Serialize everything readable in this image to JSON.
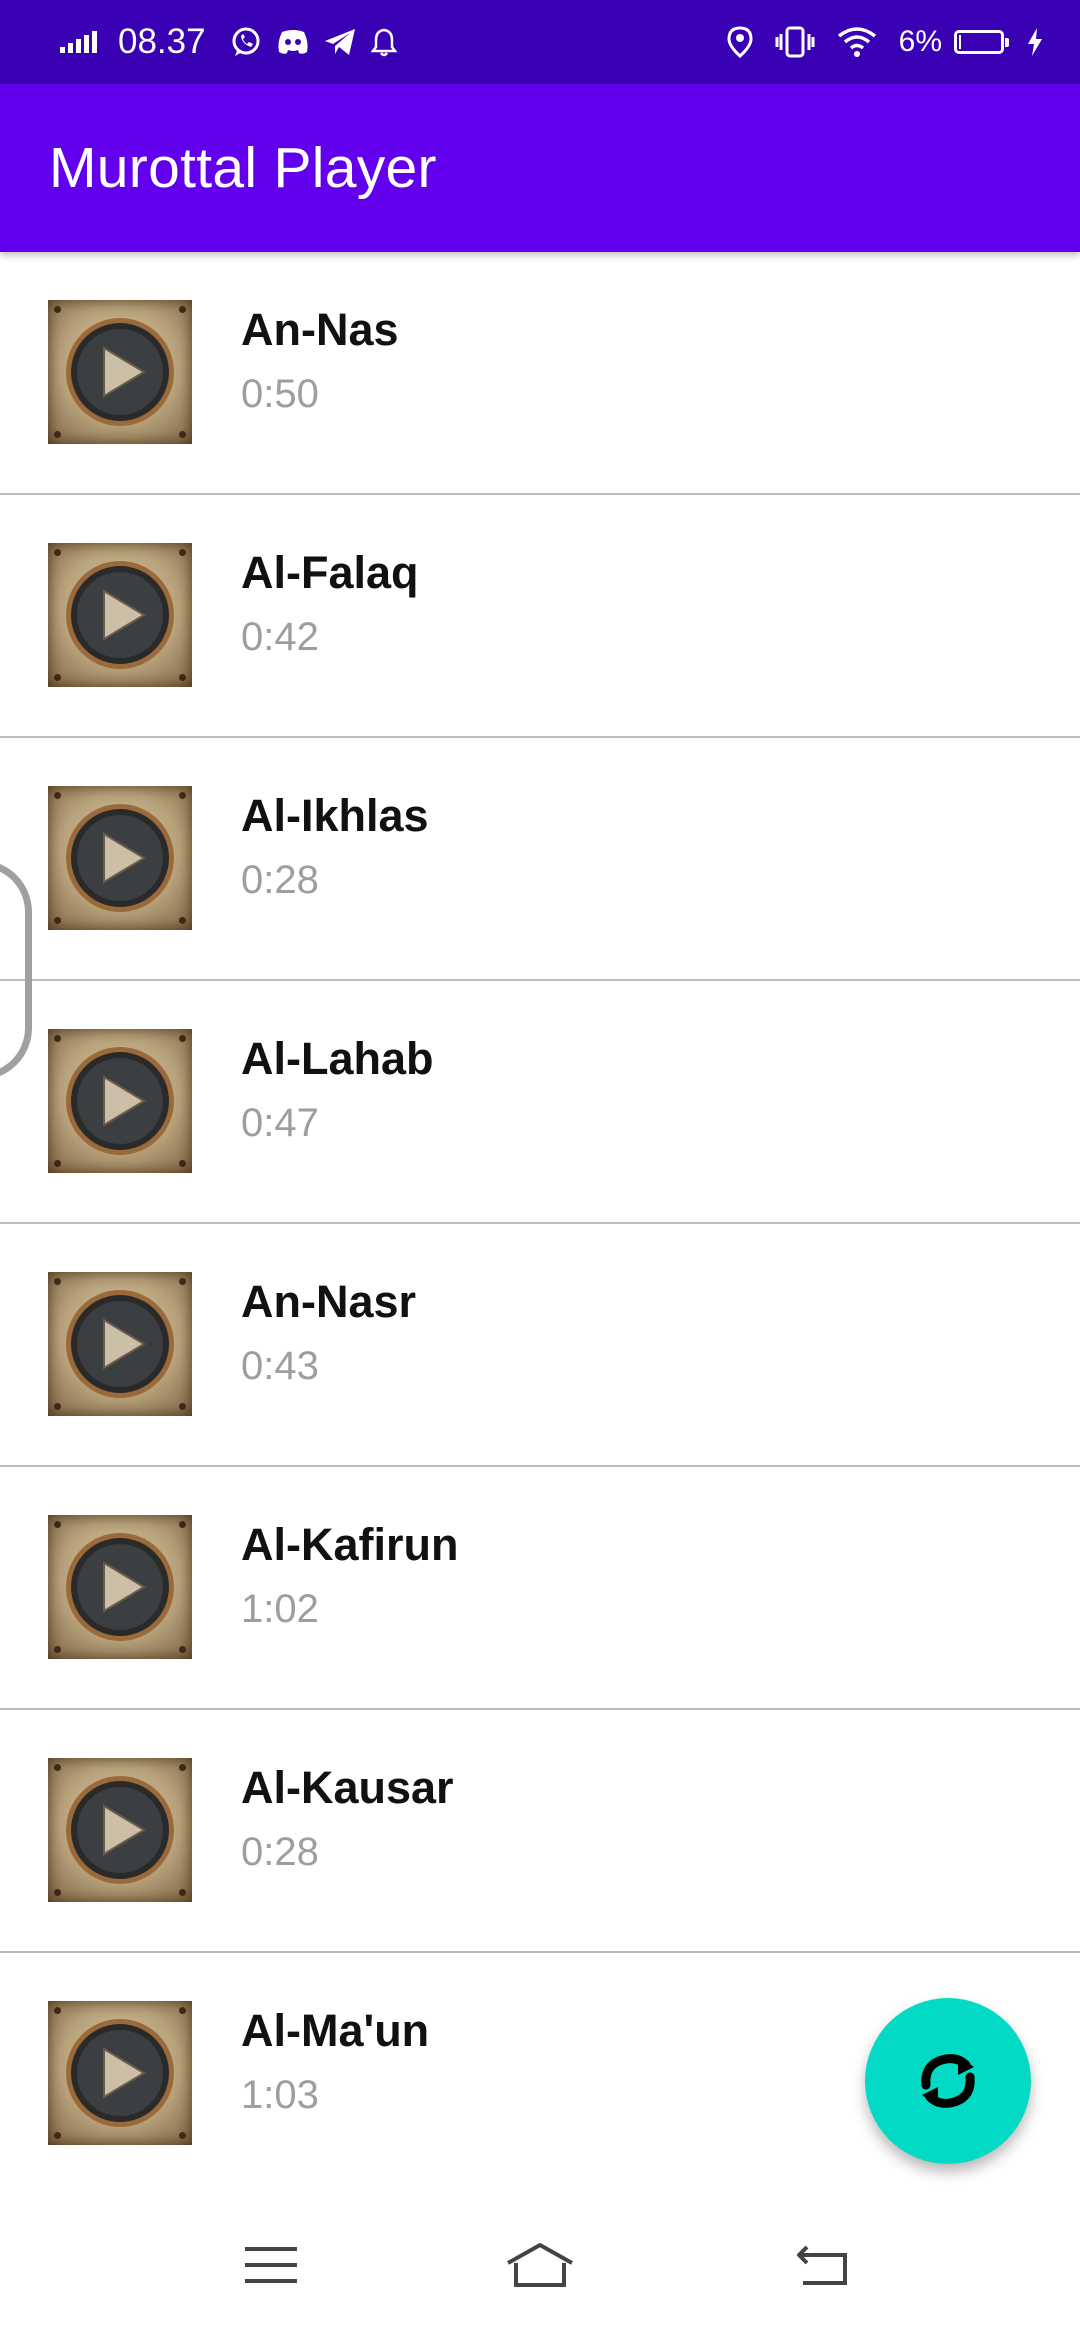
{
  "status_bar": {
    "time": "08.37",
    "battery_percent": "6%",
    "battery_level": 0.06,
    "left_icons": [
      "signal-icon",
      "whatsapp-icon",
      "discord-icon",
      "telegram-icon",
      "notification-bell-icon"
    ],
    "right_icons": [
      "location-icon",
      "vibrate-icon",
      "wifi-icon",
      "battery-icon",
      "charging-icon"
    ]
  },
  "app_bar": {
    "title": "Murottal Player"
  },
  "tracks": [
    {
      "title": "An-Nas",
      "duration": "0:50"
    },
    {
      "title": "Al-Falaq",
      "duration": "0:42"
    },
    {
      "title": "Al-Ikhlas",
      "duration": "0:28"
    },
    {
      "title": "Al-Lahab",
      "duration": "0:47"
    },
    {
      "title": "An-Nasr",
      "duration": "0:43"
    },
    {
      "title": "Al-Kafirun",
      "duration": "1:02"
    },
    {
      "title": "Al-Kausar",
      "duration": "0:28"
    },
    {
      "title": "Al-Ma'un",
      "duration": "1:03"
    }
  ],
  "fab": {
    "icon": "refresh-icon"
  },
  "nav_bar": {
    "icons": [
      "menu-icon",
      "home-icon",
      "back-icon"
    ]
  },
  "colors": {
    "status_bar": "#3a00b4",
    "app_bar": "#6200ee",
    "fab": "#03dac5",
    "divider": "#bdbdbd",
    "duration_text": "#9e9e9e"
  }
}
